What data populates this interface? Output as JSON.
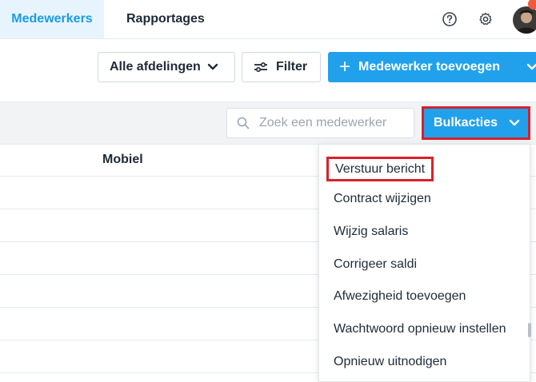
{
  "nav": {
    "tabs": [
      {
        "label": "Medewerkers",
        "active": true
      },
      {
        "label": "Rapportages",
        "active": false
      }
    ],
    "icons": [
      "help-icon",
      "gear-icon",
      "avatar"
    ]
  },
  "toolbar": {
    "department_label": "Alle afdelingen",
    "filter_label": "Filter",
    "add_employee_label": "Medewerker toevoegen"
  },
  "list_controls": {
    "search_placeholder": "Zoek een medewerker",
    "bulk_actions_label": "Bulkacties"
  },
  "table": {
    "columns": [
      "Mobiel"
    ]
  },
  "bulk_menu": {
    "items": [
      "Verstuur bericht",
      "Contract wijzigen",
      "Wijzig salaris",
      "Corrigeer saldi",
      "Afwezigheid toevoegen",
      "Wachtwoord opnieuw instellen",
      "Opnieuw uitnodigen"
    ]
  },
  "colors": {
    "accent": "#21a1ec",
    "active_tab_bg": "#e8f4fd",
    "highlight_border": "#d9202a"
  }
}
